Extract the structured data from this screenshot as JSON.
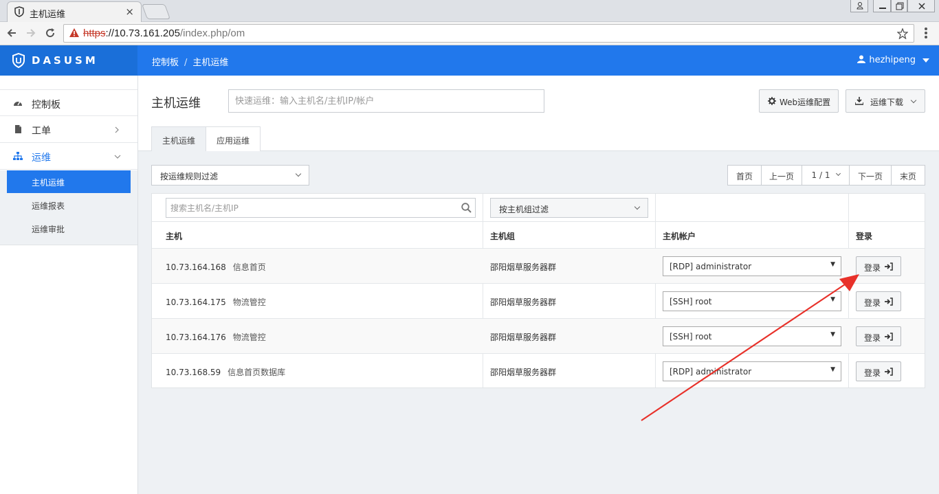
{
  "browser": {
    "tab_title": "主机运维",
    "tab_close": "×",
    "url_scheme": "https",
    "url_rest_host": "://10.73.161.205",
    "url_rest_path": "/index.php/om"
  },
  "header": {
    "brand": "DASUSM",
    "breadcrumb": [
      "控制板",
      "主机运维"
    ],
    "breadcrumb_sep": "/",
    "user": "hezhipeng"
  },
  "sidebar": {
    "items": [
      {
        "label": "控制板",
        "icon": "dashboard-icon"
      },
      {
        "label": "工单",
        "icon": "document-icon"
      },
      {
        "label": "运维",
        "icon": "sitemap-icon"
      }
    ],
    "sub_items": [
      "主机运维",
      "运维报表",
      "运维审批"
    ]
  },
  "main": {
    "title": "主机运维",
    "quick_placeholder": "快速运维：输入主机名/主机IP/帐户",
    "web_config_label": "Web运维配置",
    "download_label": "运维下载",
    "tabs": [
      "主机运维",
      "应用运维"
    ],
    "rule_filter": "按运维规则过滤",
    "pager": [
      "首页",
      "上一页",
      "1 / 1",
      "下一页",
      "末页"
    ]
  },
  "table": {
    "search_placeholder": "搜索主机名/主机IP",
    "group_filter": "按主机组过滤",
    "headers": [
      "主机",
      "主机组",
      "主机帐户",
      "登录"
    ],
    "login_label": "登录",
    "rows": [
      {
        "ip": "10.73.164.168",
        "name": "信息首页",
        "group": "邵阳烟草服务器群",
        "account": "[RDP] administrator"
      },
      {
        "ip": "10.73.164.175",
        "name": "物流管控",
        "group": "邵阳烟草服务器群",
        "account": "[SSH] root"
      },
      {
        "ip": "10.73.164.176",
        "name": "物流管控",
        "group": "邵阳烟草服务器群",
        "account": "[SSH] root"
      },
      {
        "ip": "10.73.168.59",
        "name": "信息首页数据库",
        "group": "邵阳烟草服务器群",
        "account": "[RDP] administrator"
      }
    ]
  },
  "colors": {
    "accent": "#2178ec",
    "annotation": "#e8312a"
  }
}
